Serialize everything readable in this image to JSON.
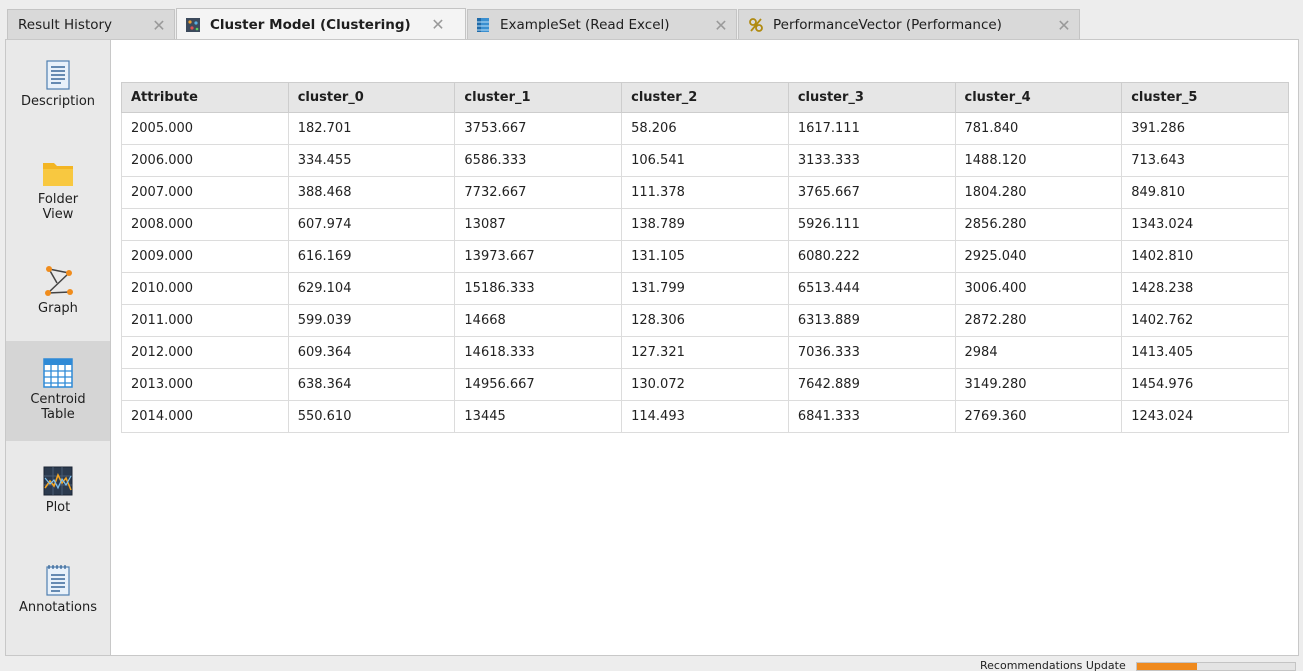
{
  "tabs": [
    {
      "label": "Result History",
      "icon": "none",
      "active": false
    },
    {
      "label": "Cluster Model (Clustering)",
      "icon": "cluster-model-icon",
      "active": true
    },
    {
      "label": "ExampleSet (Read Excel)",
      "icon": "exampleset-icon",
      "active": false
    },
    {
      "label": "PerformanceVector (Performance)",
      "icon": "performance-icon",
      "active": false
    }
  ],
  "tab_close_glyph": "✕",
  "sidebar": {
    "items": [
      {
        "label": "Description",
        "icon": "document-icon"
      },
      {
        "label": "Folder View",
        "icon": "folder-icon"
      },
      {
        "label": "Graph",
        "icon": "graph-icon"
      },
      {
        "label": "Centroid Table",
        "icon": "table-icon",
        "active": true
      },
      {
        "label": "Plot",
        "icon": "plot-icon"
      },
      {
        "label": "Annotations",
        "icon": "notepad-icon"
      }
    ]
  },
  "table": {
    "headers": [
      "Attribute",
      "cluster_0",
      "cluster_1",
      "cluster_2",
      "cluster_3",
      "cluster_4",
      "cluster_5"
    ],
    "rows": [
      [
        "2005.000",
        "182.701",
        "3753.667",
        "58.206",
        "1617.111",
        "781.840",
        "391.286"
      ],
      [
        "2006.000",
        "334.455",
        "6586.333",
        "106.541",
        "3133.333",
        "1488.120",
        "713.643"
      ],
      [
        "2007.000",
        "388.468",
        "7732.667",
        "111.378",
        "3765.667",
        "1804.280",
        "849.810"
      ],
      [
        "2008.000",
        "607.974",
        "13087",
        "138.789",
        "5926.111",
        "2856.280",
        "1343.024"
      ],
      [
        "2009.000",
        "616.169",
        "13973.667",
        "131.105",
        "6080.222",
        "2925.040",
        "1402.810"
      ],
      [
        "2010.000",
        "629.104",
        "15186.333",
        "131.799",
        "6513.444",
        "3006.400",
        "1428.238"
      ],
      [
        "2011.000",
        "599.039",
        "14668",
        "128.306",
        "6313.889",
        "2872.280",
        "1402.762"
      ],
      [
        "2012.000",
        "609.364",
        "14618.333",
        "127.321",
        "7036.333",
        "2984",
        "1413.405"
      ],
      [
        "2013.000",
        "638.364",
        "14956.667",
        "130.072",
        "7642.889",
        "3149.280",
        "1454.976"
      ],
      [
        "2014.000",
        "550.610",
        "13445",
        "114.493",
        "6841.333",
        "2769.360",
        "1243.024"
      ]
    ]
  },
  "status": {
    "text": "Recommendations Update",
    "progress": 0.38,
    "accent": "#ef8a1e"
  }
}
